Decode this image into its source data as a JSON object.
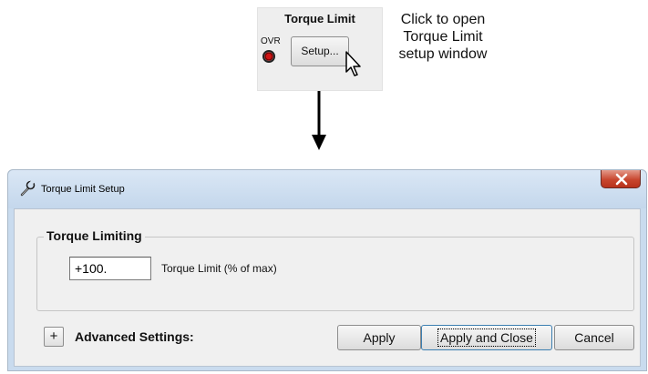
{
  "top_panel": {
    "group_title": "Torque Limit",
    "ovr_label": "OVR",
    "setup_button_label": "Setup..."
  },
  "callout": {
    "lines": [
      "Click to open",
      "Torque Limit",
      "setup window"
    ]
  },
  "dialog": {
    "title": "Torque Limit Setup",
    "groupbox_title": "Torque Limiting",
    "torque_limit_value": "+100.",
    "torque_limit_label": "Torque Limit (% of max)",
    "expand_label": "+",
    "advanced_settings_label": "Advanced Settings:",
    "buttons": {
      "apply": "Apply",
      "apply_and_close": "Apply and Close",
      "cancel": "Cancel"
    }
  },
  "icons": {
    "title_icon": "wrench-icon",
    "close_icon": "close-icon",
    "led": "status-led-icon",
    "cursor": "mouse-pointer-icon",
    "arrow": "arrow-down-icon"
  },
  "colors": {
    "titlebar": "#c9dbee",
    "close_button": "#c8472f",
    "led_red": "#d01515",
    "focus_border": "#3c7fb1"
  }
}
